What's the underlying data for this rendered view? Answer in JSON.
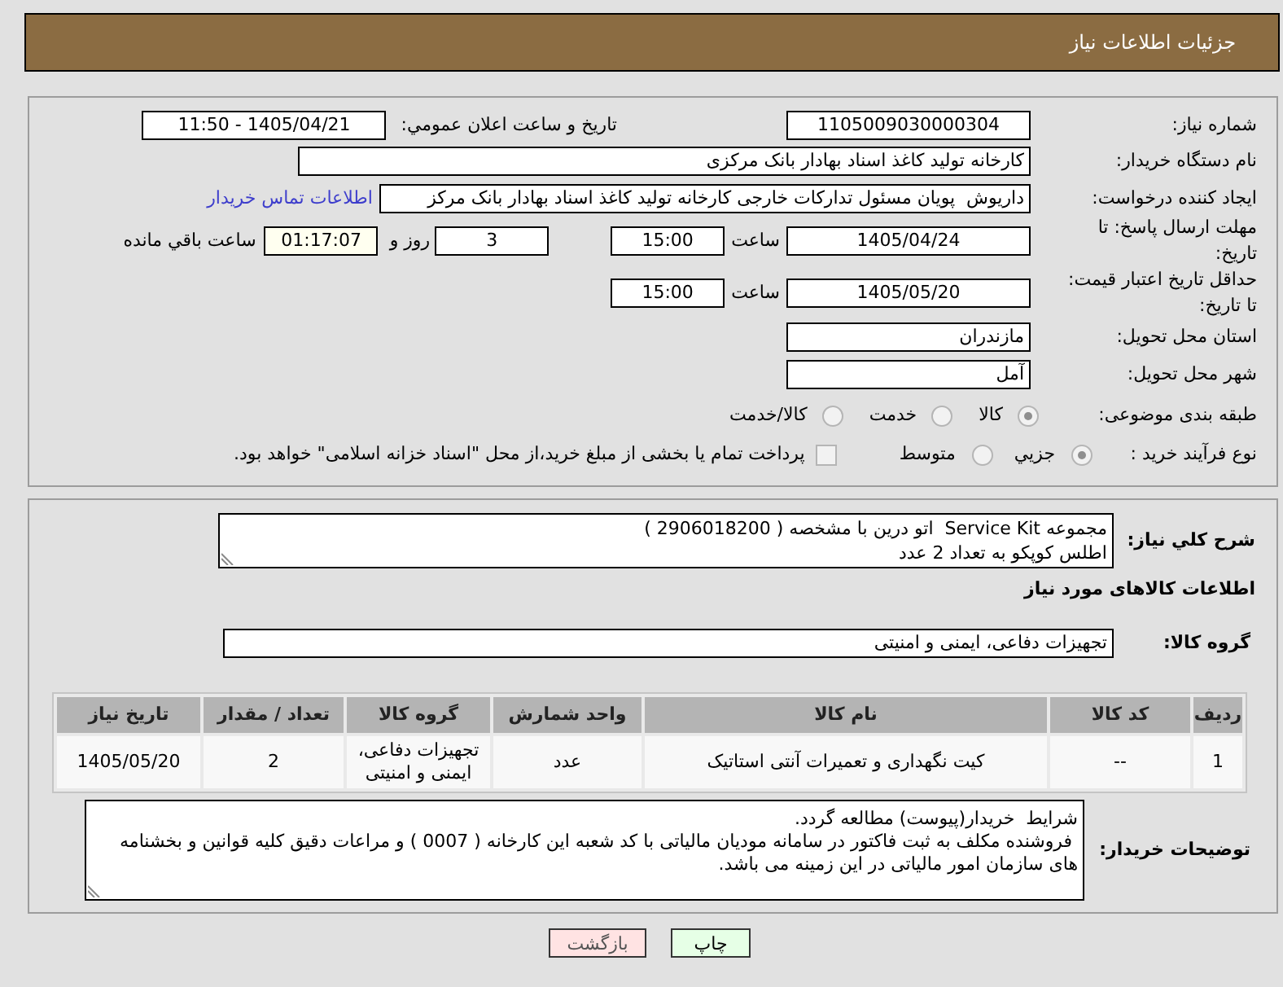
{
  "header": {
    "title": "جزئیات اطلاعات نیاز"
  },
  "need_info": {
    "need_number": {
      "label": "شماره نیاز:",
      "value": "1105009030000304"
    },
    "public_announcement": {
      "label": "تاریخ و ساعت اعلان عمومي:",
      "value": "1405/04/21 - 11:50"
    },
    "buyer_org": {
      "label": "نام دستگاه خریدار:",
      "value": "کارخانه تولید کاغذ اسناد بهادار بانک مرکزی"
    },
    "requester": {
      "label": "ایجاد کننده درخواست:",
      "value": "داریوش  پویان مسئول تدارکات خارجی کارخانه تولید کاغذ اسناد بهادار بانک مرکز",
      "link": "اطلاعات تماس خریدار"
    },
    "reply_deadline": {
      "label": "مهلت ارسال پاسخ: تا تاریخ:",
      "date": "1405/04/24",
      "time_label": "ساعت",
      "time": "15:00",
      "days": "3",
      "days_label": "روز و",
      "remaining": "01:17:07",
      "remaining_label": "ساعت باقي مانده"
    },
    "price_validity": {
      "label": "حداقل تاریخ اعتبار قیمت: تا تاریخ:",
      "date": "1405/05/20",
      "time_label": "ساعت",
      "time": "15:00"
    },
    "delivery_province": {
      "label": "استان محل تحویل:",
      "value": "مازندران"
    },
    "delivery_city": {
      "label": "شهر محل تحویل:",
      "value": "آمل"
    },
    "subject_category": {
      "label": "طبقه بندی موضوعی:",
      "options": [
        {
          "label": "کالا",
          "selected": true
        },
        {
          "label": "خدمت",
          "selected": false
        },
        {
          "label": "کالا/خدمت",
          "selected": false
        }
      ]
    },
    "purchase_process": {
      "label": "نوع فرآیند خرید :",
      "options": [
        {
          "label": "جزيي",
          "selected": true
        },
        {
          "label": "متوسط",
          "selected": false
        }
      ],
      "treasury_payment": {
        "label": "پرداخت تمام یا بخشی از مبلغ خرید،از محل \"اسناد خزانه اسلامی\" خواهد بود.",
        "checked": false
      }
    }
  },
  "need_description": {
    "label": "شرح کلي نیاز:",
    "value": "مجموعه Service Kit  اتو درین با مشخصه ( 2906018200 )\nاطلس کوپکو به تعداد 2 عدد"
  },
  "goods": {
    "title": "اطلاعات کالاهای مورد نیاز",
    "group": {
      "label": "گروه کالا:",
      "value": "تجهیزات دفاعی، ایمنی و امنیتی"
    },
    "table": {
      "columns": [
        "ردیف",
        "کد کالا",
        "نام کالا",
        "واحد شمارش",
        "گروه کالا",
        "تعداد / مقدار",
        "تاریخ نیاز"
      ],
      "rows": [
        [
          "1",
          "--",
          "کیت نگهداری و تعمیرات آنتی استاتیک",
          "عدد",
          "تجهیزات دفاعی، ایمنی و امنیتی",
          "2",
          "1405/05/20"
        ]
      ]
    }
  },
  "buyer_notes": {
    "label": "توضیحات خریدار:",
    "value": "شرایط  خریدار(پیوست) مطالعه گردد.\n فروشنده مکلف به ثبت فاکتور در سامانه مودیان مالیاتی با کد شعبه این کارخانه ( 0007 ) و مراعات دقیق کلیه قوانین و بخشنامه های سازمان امور مالیاتی در این زمینه می باشد."
  },
  "buttons": [
    {
      "label": "چاپ",
      "kind": "print"
    },
    {
      "label": "بازگشت",
      "kind": "back"
    }
  ]
}
